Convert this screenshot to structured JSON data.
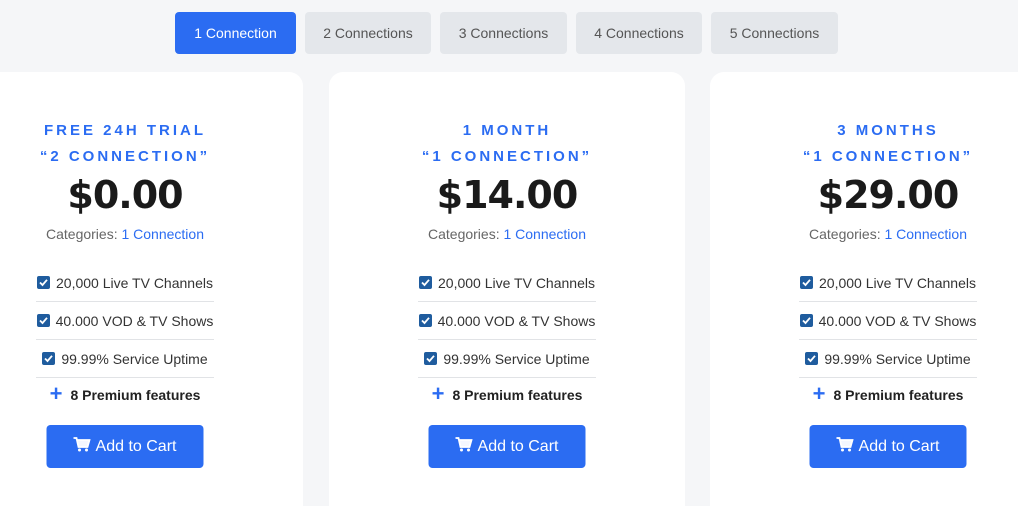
{
  "tabs": [
    {
      "label": "1 Connection",
      "active": true
    },
    {
      "label": "2 Connections",
      "active": false
    },
    {
      "label": "3 Connections",
      "active": false
    },
    {
      "label": "4 Connections",
      "active": false
    },
    {
      "label": "5 Connections",
      "active": false
    }
  ],
  "plans": [
    {
      "title_line1": "FREE 24H TRIAL",
      "title_line2": "“2 CONNECTION”",
      "price": "$0.00",
      "categories_label": "Categories:",
      "categories_value": "1 Connection",
      "features": [
        "20,000 Live TV Channels",
        "40.000 VOD & TV Shows",
        "99.99% Service Uptime"
      ],
      "premium": "8 Premium features",
      "button_label": "Add to Cart"
    },
    {
      "title_line1": "1 MONTH",
      "title_line2": "“1 CONNECTION”",
      "price": "$14.00",
      "categories_label": "Categories:",
      "categories_value": "1 Connection",
      "features": [
        "20,000 Live TV Channels",
        "40.000 VOD & TV Shows",
        "99.99% Service Uptime"
      ],
      "premium": "8 Premium features",
      "button_label": "Add to Cart"
    },
    {
      "title_line1": "3 MONTHS",
      "title_line2": "“1 CONNECTION”",
      "price": "$29.00",
      "categories_label": "Categories:",
      "categories_value": "1 Connection",
      "features": [
        "20,000 Live TV Channels",
        "40.000 VOD & TV Shows",
        "99.99% Service Uptime"
      ],
      "premium": "8 Premium features",
      "button_label": "Add to Cart"
    }
  ],
  "icons": {
    "feature": "checkbox-checked-icon",
    "premium": "plus-icon",
    "button": "shopping-cart-icon"
  },
  "colors": {
    "accent": "#2b6cf2",
    "checkbox": "#1f5c9e",
    "tab_inactive": "#e4e7eb",
    "page_bg": "#f5f6f8"
  }
}
